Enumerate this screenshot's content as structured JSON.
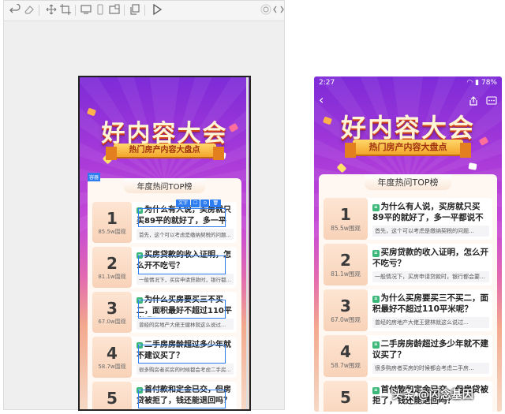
{
  "phone_status": {
    "time": "2:27",
    "battery": "78%"
  },
  "banner": {
    "title": "好内容大会",
    "subtitle": "热门房产内容大盘点"
  },
  "section": {
    "title": "年度热问TOP榜"
  },
  "editor": {
    "component_tag": "容器",
    "selection_tools": [
      "文字",
      "☐",
      "⊙",
      "🗑"
    ]
  },
  "items": [
    {
      "rank": "1",
      "views": "85.5w围观",
      "title": "为什么有人说，买房就只买89平的就好了，多一平都说不过去？",
      "answer": "首先，这个可以考虑是缴纳契税的问题..."
    },
    {
      "rank": "2",
      "views": "81.1w围观",
      "title": "买房贷款的收入证明，怎么开不吃亏？",
      "answer": "一般情况下，买房申请贷款时，银行都会要求..."
    },
    {
      "rank": "3",
      "views": "67.0w围观",
      "title": "为什么买房要买三不买二，面积最好不超过110平米呢？",
      "answer": "曾经的房地产大佬王健林就这么说过..."
    },
    {
      "rank": "4",
      "views": "58.7w围观",
      "title": "二手房房龄超过多少年就不建议买了？",
      "answer": "很多购房者买房的时候都会考虑二手房..."
    },
    {
      "rank": "5",
      "views": "",
      "title": "首付款和定金已交，但房贷被拒了，钱还能退回吗？",
      "answer": ""
    }
  ],
  "watermark": "头条 @闪念基因",
  "colors": {
    "accent": "#2d7cf0",
    "question_icon": "#3cb97a",
    "banner_top": "#7d2bd8",
    "ribbon": "#f3a52a"
  }
}
